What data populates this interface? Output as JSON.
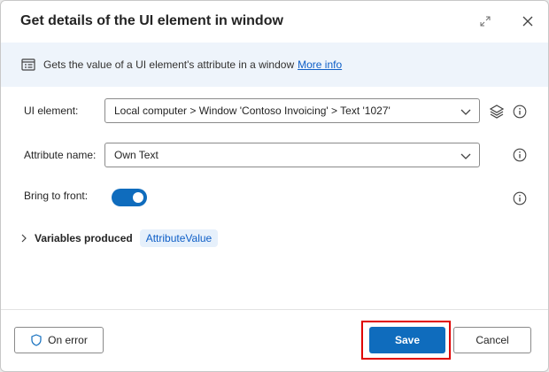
{
  "dialog": {
    "title": "Get details of the UI element in window",
    "expand_icon": "expand-icon",
    "close_icon": "close-icon"
  },
  "info": {
    "icon": "document-list-icon",
    "text": "Gets the value of a UI element's attribute in a window",
    "link": "More info"
  },
  "fields": {
    "ui_element": {
      "label": "UI element:",
      "value": "Local computer > Window 'Contoso Invoicing' > Text '1027'"
    },
    "attribute_name": {
      "label": "Attribute name:",
      "value": "Own Text"
    },
    "bring_to_front": {
      "label": "Bring to front:",
      "enabled": true
    }
  },
  "variables": {
    "label": "Variables produced",
    "items": [
      "AttributeValue"
    ]
  },
  "footer": {
    "on_error": "On error",
    "save": "Save",
    "cancel": "Cancel"
  },
  "colors": {
    "accent": "#0f6cbd",
    "highlight": "#e00000",
    "info_bg": "#eef4fb"
  }
}
